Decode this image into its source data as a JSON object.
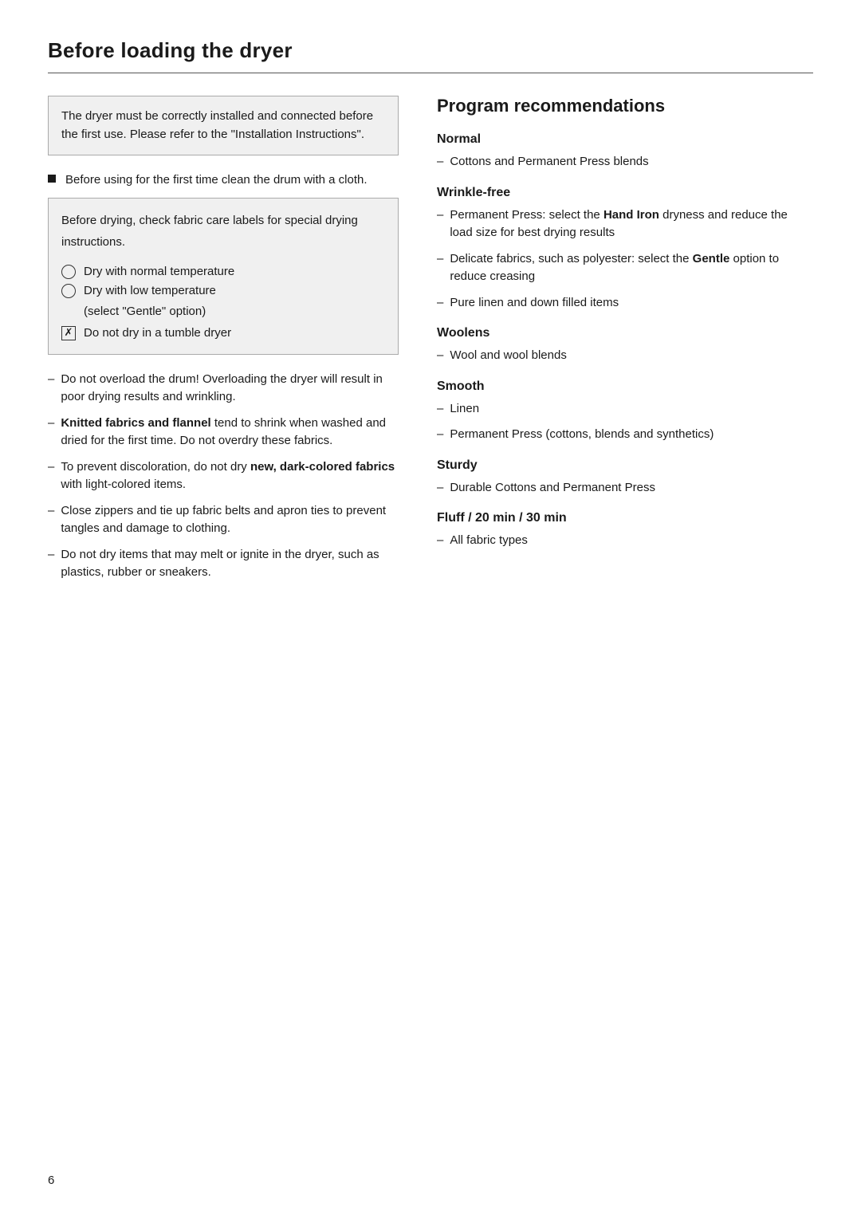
{
  "page": {
    "title": "Before loading the dryer",
    "page_number": "6"
  },
  "left": {
    "info_box": "The dryer must be correctly installed and connected before the first use. Please refer to the \"Installation Instructions\".",
    "bullet1_text": "Before using for the first time clean the drum with a cloth.",
    "fabric_box_intro": "Before drying, check fabric care labels for special drying instructions.",
    "fabric_icon1": "Dry with normal temperature",
    "fabric_icon2": "Dry with low temperature",
    "fabric_icon2_sub": "(select \"Gentle\" option)",
    "fabric_icon3": "Do not dry in a tumble dryer",
    "dash1": "Do not overload the drum! Overloading the dryer will result in poor drying results and wrinkling.",
    "dash2_pre": "",
    "dash2_bold": "Knitted fabrics and flannel",
    "dash2_after": " tend to shrink when washed and dried for the first time. Do not overdry these fabrics.",
    "dash3_pre": "To prevent discoloration, do not dry ",
    "dash3_bold": "new, dark-colored fabrics",
    "dash3_after": " with light-colored items.",
    "dash4": "Close zippers and tie up fabric belts and apron ties to prevent tangles and damage to clothing.",
    "dash5": "Do not dry items that may melt or ignite in the dryer, such as plastics, rubber or sneakers."
  },
  "right": {
    "title": "Program recommendations",
    "sections": [
      {
        "heading": "Normal",
        "items": [
          "Cottons and Permanent Press blends"
        ]
      },
      {
        "heading": "Wrinkle-free",
        "items": [
          "Permanent Press: select the Hand Iron dryness and reduce the load size for best drying results",
          "Delicate fabrics, such as polyester: select the Gentle option to reduce creasing",
          "Pure linen and down filled items"
        ],
        "bold_in_items": [
          {
            "index": 0,
            "bold_text": "Hand Iron"
          },
          {
            "index": 1,
            "bold_text": "Gentle"
          }
        ]
      },
      {
        "heading": "Woolens",
        "items": [
          "Wool and wool blends"
        ]
      },
      {
        "heading": "Smooth",
        "items": [
          "Linen",
          "Permanent Press (cottons, blends and synthetics)"
        ]
      },
      {
        "heading": "Sturdy",
        "items": [
          "Durable Cottons and Permanent Press"
        ]
      },
      {
        "heading": "Fluff / 20 min / 30 min",
        "items": [
          "All fabric types"
        ]
      }
    ]
  }
}
